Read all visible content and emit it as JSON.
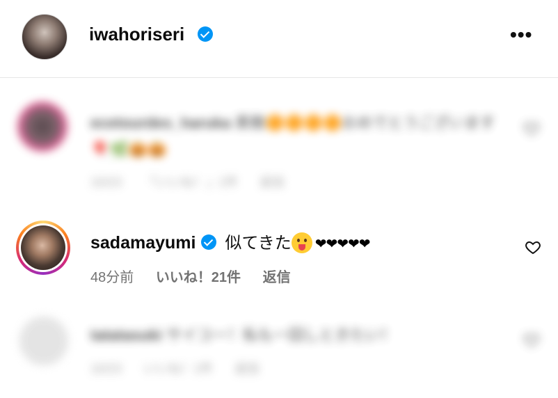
{
  "header": {
    "username": "iwahoriseri",
    "more_label": "•••"
  },
  "comments": [
    {
      "username": "ecetourdes_haruka",
      "text": "素敵🟠🟠🟠🟠おめでとうございます🎈🌿🎃🎃",
      "time": "10/23",
      "likes": "「いいね！」1件",
      "reply": "返信",
      "blurred": true
    },
    {
      "username": "sadamayumi",
      "text": "似てきた",
      "hearts": "❤❤❤❤❤",
      "time": "48分前",
      "likes": "いいね！21件",
      "reply": "返信",
      "blurred": false
    },
    {
      "username": "tatatasuki",
      "text": "サイコー！私も一回しときたい！",
      "time": "10/23",
      "likes": "いいね！1件",
      "reply": "返信",
      "blurred": true
    }
  ],
  "colors": {
    "verified": "#0095f6",
    "meta": "#737373"
  }
}
